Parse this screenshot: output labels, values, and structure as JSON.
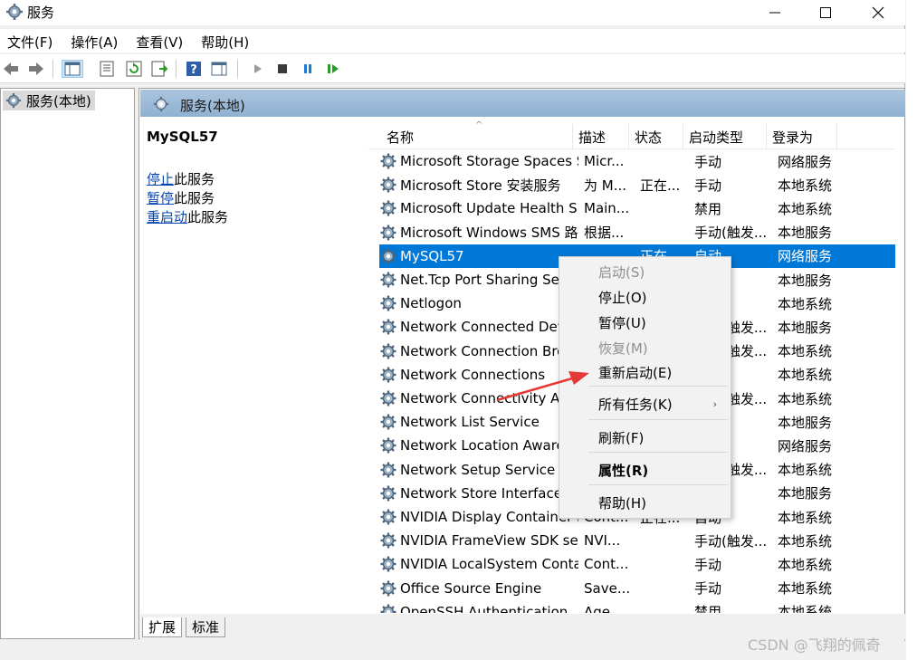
{
  "window": {
    "title": "服务",
    "minimize": "—",
    "maximize": "☐",
    "close": "✕"
  },
  "menu": [
    "文件(F)",
    "操作(A)",
    "查看(V)",
    "帮助(H)"
  ],
  "tree": {
    "root_label": "服务(本地)"
  },
  "content": {
    "header": "服务(本地)"
  },
  "description": {
    "service_name": "MySQL57",
    "actions": [
      {
        "link": "停止",
        "suffix": "此服务"
      },
      {
        "link": "暂停",
        "suffix": "此服务"
      },
      {
        "link": "重启动",
        "suffix": "此服务"
      }
    ]
  },
  "list": {
    "columns": [
      "名称",
      "描述",
      "状态",
      "启动类型",
      "登录为"
    ],
    "sort_caret": "^",
    "rows": [
      {
        "name": "Microsoft Storage Spaces S...",
        "desc": "Micr...",
        "status": "",
        "type": "手动",
        "logon": "网络服务"
      },
      {
        "name": "Microsoft Store 安装服务",
        "desc": "为 M...",
        "status": "正在...",
        "type": "手动",
        "logon": "本地系统"
      },
      {
        "name": "Microsoft Update Health S...",
        "desc": "Main...",
        "status": "",
        "type": "禁用",
        "logon": "本地系统"
      },
      {
        "name": "Microsoft Windows SMS 路...",
        "desc": "根据...",
        "status": "",
        "type": "手动(触发...",
        "logon": "本地服务"
      },
      {
        "name": "MySQL57",
        "desc": "",
        "status": "正在...",
        "type": "自动",
        "logon": "网络服务"
      },
      {
        "name": "Net.Tcp Port Sharing Service",
        "desc": "",
        "status": "",
        "type": "",
        "logon": "本地服务"
      },
      {
        "name": "Netlogon",
        "desc": "",
        "status": "",
        "type": "",
        "logon": "本地系统"
      },
      {
        "name": "Network Connected Devices Auto-Setup",
        "desc": "",
        "status": "",
        "type": "手动(触发...",
        "logon": "本地服务"
      },
      {
        "name": "Network Connection Broker",
        "desc": "",
        "status": "",
        "type": "手动(触发...",
        "logon": "本地系统"
      },
      {
        "name": "Network Connections",
        "desc": "",
        "status": "",
        "type": "",
        "logon": "本地系统"
      },
      {
        "name": "Network Connectivity Assistant",
        "desc": "",
        "status": "",
        "type": "手动(触发...",
        "logon": "本地系统"
      },
      {
        "name": "Network List Service",
        "desc": "",
        "status": "",
        "type": "",
        "logon": "本地服务"
      },
      {
        "name": "Network Location Awareness",
        "desc": "",
        "status": "",
        "type": "",
        "logon": "网络服务"
      },
      {
        "name": "Network Setup Service",
        "desc": "",
        "status": "",
        "type": "手动(触发...",
        "logon": "本地系统"
      },
      {
        "name": "Network Store Interface Service",
        "desc": "",
        "status": "",
        "type": "",
        "logon": "本地服务"
      },
      {
        "name": "NVIDIA Display Container LS",
        "desc": "Cont...",
        "status": "正在...",
        "type": "自动",
        "logon": "本地系统"
      },
      {
        "name": "NVIDIA FrameView SDK se...",
        "desc": "NVI...",
        "status": "",
        "type": "手动(触发...",
        "logon": "本地系统"
      },
      {
        "name": "NVIDIA LocalSystem Conta...",
        "desc": "Cont...",
        "status": "",
        "type": "手动",
        "logon": "本地系统"
      },
      {
        "name": "Office  Source Engine",
        "desc": "Save...",
        "status": "",
        "type": "手动",
        "logon": "本地系统"
      },
      {
        "name": "OpenSSH Authentication ...",
        "desc": "Age...",
        "status": "",
        "type": "禁用",
        "logon": "本地系统"
      }
    ]
  },
  "context_menu": {
    "items": [
      {
        "label": "启动(S)",
        "disabled": true
      },
      {
        "label": "停止(O)"
      },
      {
        "label": "暂停(U)"
      },
      {
        "label": "恢复(M)",
        "disabled": true
      },
      {
        "label": "重新启动(E)"
      },
      {
        "label": "所有任务(K)",
        "submenu": "›"
      },
      {
        "label": "刷新(F)"
      },
      {
        "label": "属性(R)",
        "bold": true
      },
      {
        "label": "帮助(H)"
      }
    ]
  },
  "tabs": [
    "扩展",
    "标准"
  ],
  "watermark": "CSDN @飞翔的佩奇",
  "colors": {
    "selection": "#0078d7",
    "header_band": "#9dbad7",
    "link": "#0645ad",
    "annotation_arrow": "#e53935"
  }
}
